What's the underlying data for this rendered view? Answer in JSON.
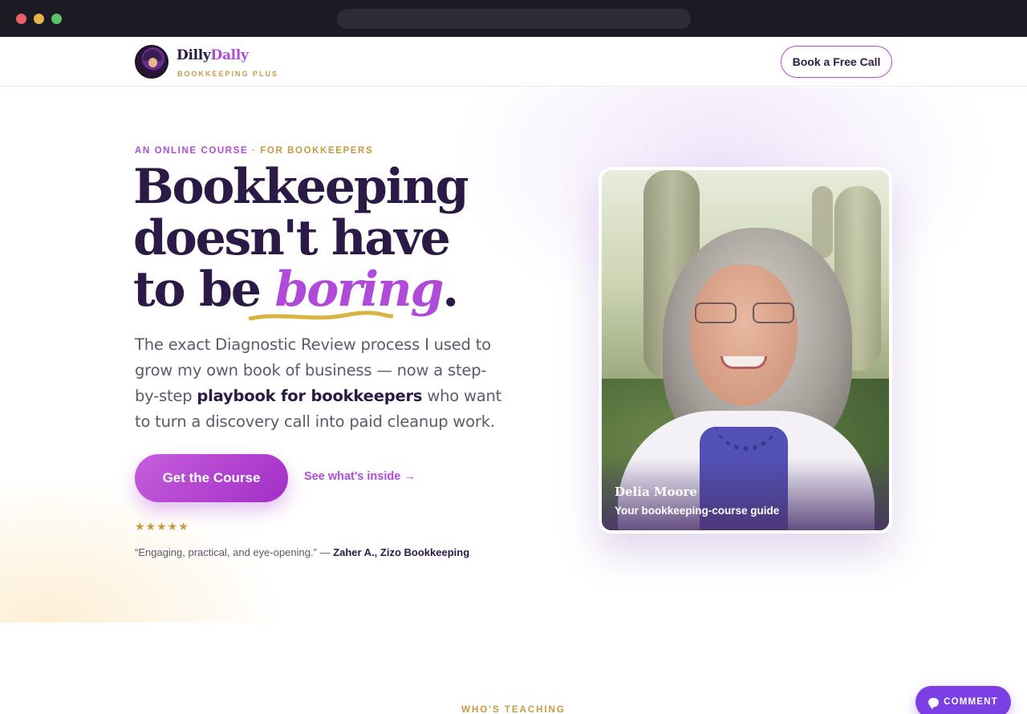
{
  "colors": {
    "brand_purple": "#b04ad8",
    "brand_gold": "#c89a3e",
    "ink": "#2a1a45",
    "comment_purple": "#7b3fe4"
  },
  "header": {
    "brand_first": "Dilly",
    "brand_second": "Dally",
    "brand_tagline": "BOOKKEEPING PLUS",
    "cta_label": "Book a Free Call"
  },
  "hero": {
    "eyebrow_left": "AN ONLINE COURSE",
    "eyebrow_sep": " · ",
    "eyebrow_right": "FOR BOOKKEEPERS",
    "headline_line1": "Bookkeeping",
    "headline_line2": "doesn't have",
    "headline_line3_start": "to be ",
    "headline_emphasis": "boring",
    "headline_end": ".",
    "lede_start": "The exact Diagnostic Review process I used to grow my own book of business — now a step-by-step ",
    "lede_bold": "playbook for bookkeepers",
    "lede_end": " who want to turn a discovery call into paid cleanup work.",
    "primary_cta": "Get the Course",
    "secondary_cta": "See what's inside →",
    "rating_stars": "★★★★★",
    "rating_value": 5,
    "quote_text": "“Engaging, practical, and eye-opening.” — ",
    "quote_author": "Zaher A., Zizo Bookkeeping"
  },
  "card": {
    "name": "Delia Moore",
    "role": "Your bookkeeping-course guide"
  },
  "next_section": {
    "eyebrow": "WHO'S TEACHING"
  },
  "widget": {
    "comment_label": "COMMENT",
    "icon": "chat-bubble-icon"
  }
}
